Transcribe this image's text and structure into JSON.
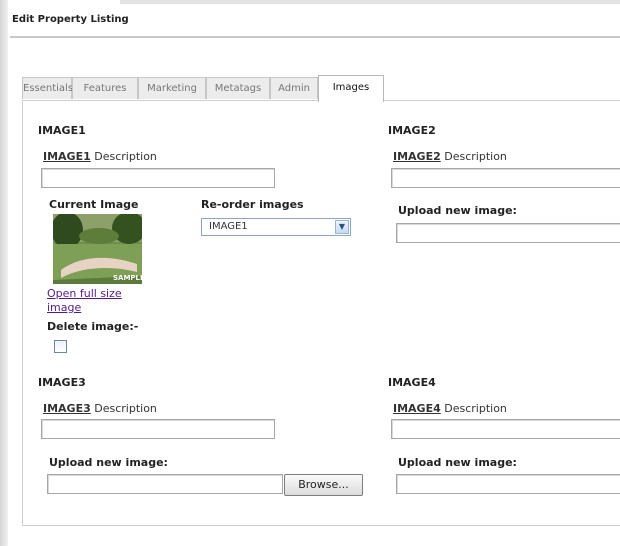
{
  "page_title": "Edit Property Listing",
  "tabs": [
    {
      "label": "Essentials"
    },
    {
      "label": "Features"
    },
    {
      "label": "Marketing"
    },
    {
      "label": "Metatags"
    },
    {
      "label": "Admin"
    },
    {
      "label": "Images"
    }
  ],
  "active_tab": "Images",
  "image1": {
    "heading": "IMAGE1",
    "desc_label_bold": "IMAGE1",
    "desc_label_rest": " Description",
    "description_value": "",
    "current_image_label": "Current Image",
    "thumbnail_badge": "SAMPLE",
    "reorder_label": "Re-order images",
    "reorder_value": "IMAGE1",
    "open_full_link": "Open full size image",
    "delete_label": "Delete image:-"
  },
  "image2": {
    "heading": "IMAGE2",
    "desc_label_bold": "IMAGE2",
    "desc_label_rest": " Description",
    "description_value": "",
    "upload_label": "Upload new image:",
    "upload_value": ""
  },
  "image3": {
    "heading": "IMAGE3",
    "desc_label_bold": "IMAGE3",
    "desc_label_rest": " Description",
    "description_value": "",
    "upload_label": "Upload new image:",
    "upload_value": "",
    "browse_label": "Browse..."
  },
  "image4": {
    "heading": "IMAGE4",
    "desc_label_bold": "IMAGE4",
    "desc_label_rest": " Description",
    "description_value": "",
    "upload_label": "Upload new image:",
    "upload_value": ""
  }
}
